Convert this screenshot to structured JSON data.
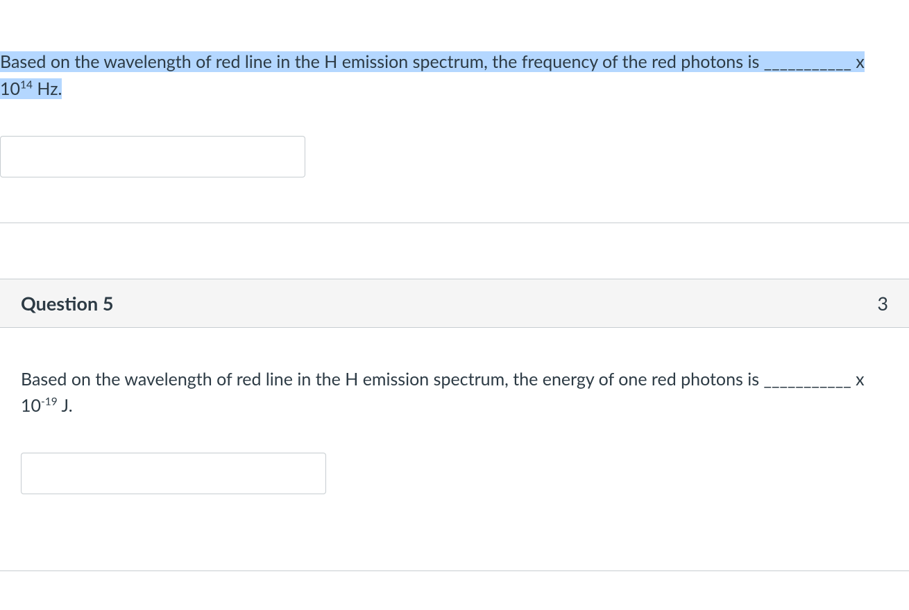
{
  "q4": {
    "text_part1": "Based on the wavelength of red line in the H emission spectrum, the frequency of the red photons is ",
    "text_blank": "___________",
    "text_part2": " x 10",
    "exp": "14",
    "text_part3": " Hz.",
    "answer_value": ""
  },
  "q5": {
    "header_title": "Question 5",
    "header_points": "3",
    "text_part1": "Based on the wavelength of red line in the H emission spectrum, the energy of one red photons is ",
    "text_blank": "___________",
    "text_part2": " x 10",
    "exp": "-19",
    "text_part3": " J.",
    "answer_value": ""
  }
}
